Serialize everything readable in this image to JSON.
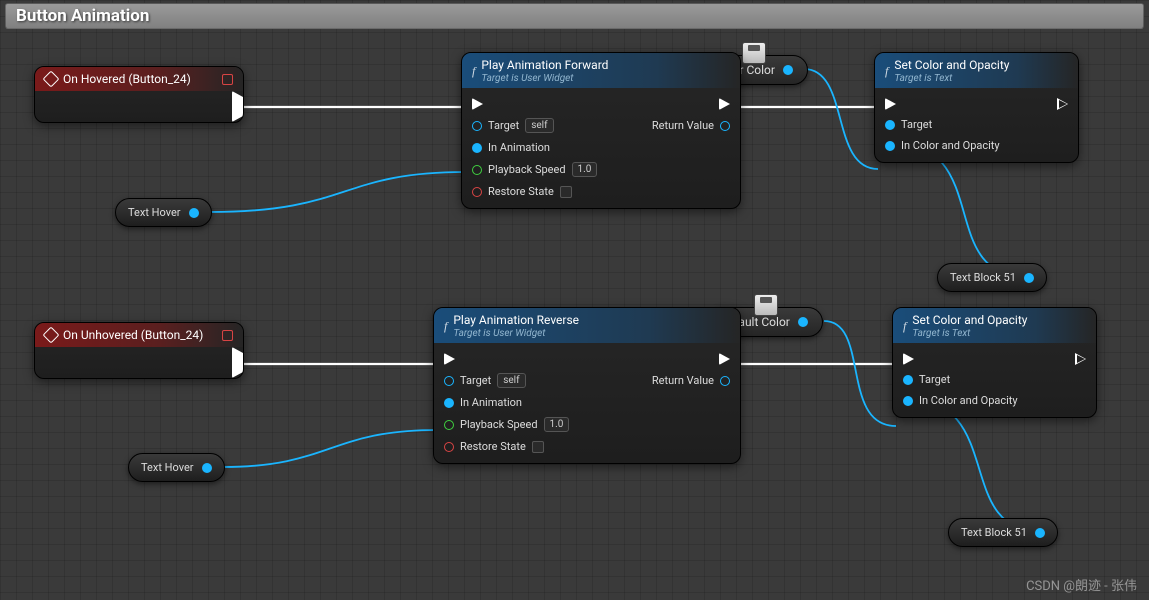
{
  "title": "Button Animation",
  "events": {
    "hovered": {
      "label": "On Hovered (Button_24)"
    },
    "unhovered": {
      "label": "On Unhovered (Button_24)"
    }
  },
  "varPills": {
    "textHover1": "Text Hover",
    "textHover2": "Text Hover",
    "textBlock1": "Text Block 51",
    "textBlock2": "Text Block 51"
  },
  "paramPills": {
    "hoverColor": "Hover Color",
    "defaultColor": "Default Color"
  },
  "funcNodes": {
    "playForward": {
      "title": "Play Animation Forward",
      "subtitle": "Target is User Widget",
      "targetLabel": "Target",
      "targetValue": "self",
      "inAnimLabel": "In Animation",
      "speedLabel": "Playback Speed",
      "speedValue": "1.0",
      "restoreLabel": "Restore State",
      "returnLabel": "Return Value"
    },
    "playReverse": {
      "title": "Play Animation Reverse",
      "subtitle": "Target is User Widget",
      "targetLabel": "Target",
      "targetValue": "self",
      "inAnimLabel": "In Animation",
      "speedLabel": "Playback Speed",
      "speedValue": "1.0",
      "restoreLabel": "Restore State",
      "returnLabel": "Return Value"
    },
    "setColor1": {
      "title": "Set Color and Opacity",
      "subtitle": "Target is Text",
      "targetLabel": "Target",
      "colorLabel": "In Color and Opacity"
    },
    "setColor2": {
      "title": "Set Color and Opacity",
      "subtitle": "Target is Text",
      "targetLabel": "Target",
      "colorLabel": "In Color and Opacity"
    }
  },
  "watermark": "CSDN @朗迹 - 张伟"
}
